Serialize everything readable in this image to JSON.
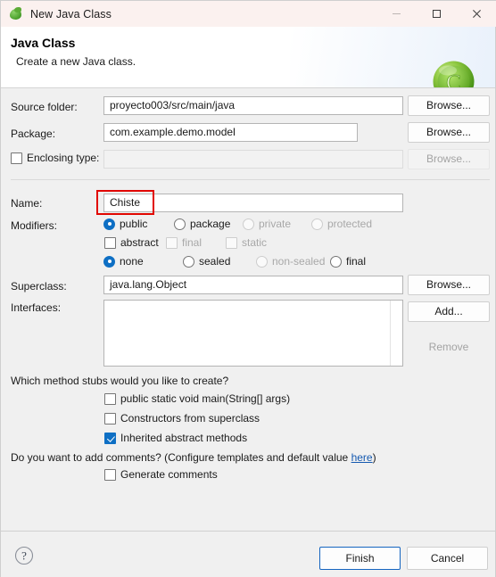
{
  "window": {
    "title": "New Java Class",
    "icon": "eclipse-java-icon",
    "controls": {
      "minimize": "minimize-icon",
      "maximize": "maximize-icon",
      "close": "close-icon"
    }
  },
  "header": {
    "title": "Java Class",
    "subtitle": "Create a new Java class.",
    "logo": "java-class-c-icon"
  },
  "form": {
    "source_folder": {
      "label": "Source folder:",
      "value": "proyecto003/src/main/java",
      "browse_label": "Browse..."
    },
    "package": {
      "label": "Package:",
      "value": "com.example.demo.model",
      "browse_label": "Browse..."
    },
    "enclosing_type": {
      "label": "Enclosing type:",
      "value": "",
      "checked": false,
      "browse_label": "Browse...",
      "disabled": true
    },
    "name": {
      "label": "Name:",
      "value": "Chiste",
      "highlighted": true
    },
    "modifiers": {
      "label": "Modifiers:",
      "access": [
        {
          "label": "public",
          "checked": true,
          "disabled": false
        },
        {
          "label": "package",
          "checked": false,
          "disabled": false
        },
        {
          "label": "private",
          "checked": false,
          "disabled": true
        },
        {
          "label": "protected",
          "checked": false,
          "disabled": true
        }
      ],
      "flags": [
        {
          "label": "abstract",
          "checked": false,
          "disabled": false
        },
        {
          "label": "final",
          "checked": false,
          "disabled": true
        },
        {
          "label": "static",
          "checked": false,
          "disabled": true
        }
      ],
      "sealed": [
        {
          "label": "none",
          "checked": true,
          "disabled": false
        },
        {
          "label": "sealed",
          "checked": false,
          "disabled": false
        },
        {
          "label": "non-sealed",
          "checked": false,
          "disabled": true
        },
        {
          "label": "final",
          "checked": false,
          "disabled": false
        }
      ]
    },
    "superclass": {
      "label": "Superclass:",
      "value": "java.lang.Object",
      "browse_label": "Browse..."
    },
    "interfaces": {
      "label": "Interfaces:",
      "items": [],
      "add_label": "Add...",
      "remove_label": "Remove",
      "remove_disabled": true
    }
  },
  "stubs": {
    "question": "Which method stubs would you like to create?",
    "options": [
      {
        "label": "public static void main(String[] args)",
        "checked": false
      },
      {
        "label": "Constructors from superclass",
        "checked": false
      },
      {
        "label": "Inherited abstract methods",
        "checked": true
      }
    ]
  },
  "comments": {
    "question_prefix": "Do you want to add comments? (Configure templates and default value ",
    "link_label": "here",
    "question_suffix": ")",
    "option": {
      "label": "Generate comments",
      "checked": false
    }
  },
  "footer": {
    "help": "help-icon",
    "finish_label": "Finish",
    "cancel_label": "Cancel"
  },
  "colors": {
    "accent": "#0e6fc4",
    "highlight": "#e10600",
    "link": "#1559b0",
    "titlebar_bg": "#fbf1ef",
    "body_bg": "#f0f0f0"
  }
}
